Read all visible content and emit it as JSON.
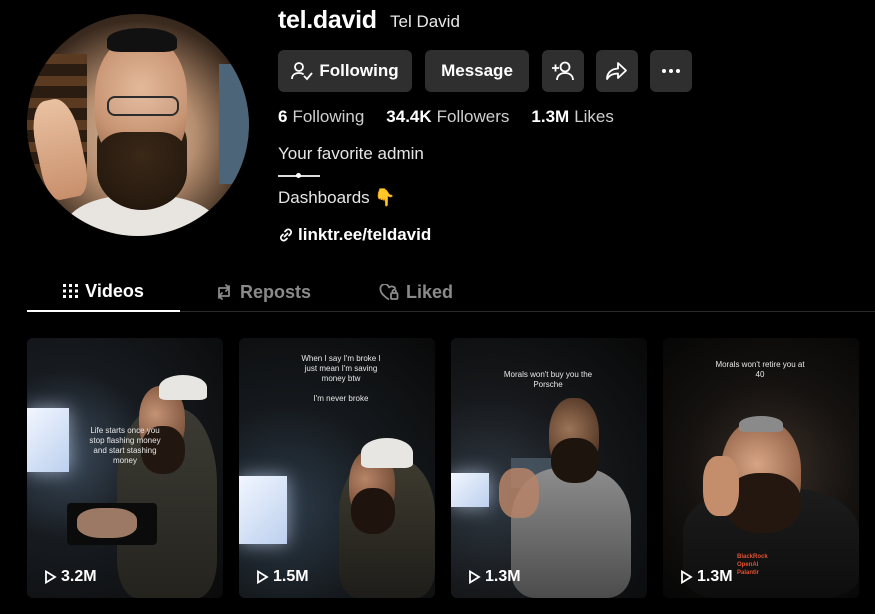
{
  "profile": {
    "username": "tel.david",
    "nickname": "Tel David",
    "buttons": {
      "following": "Following",
      "message": "Message",
      "add_friend_icon": "add-user-icon",
      "share_icon": "share-icon",
      "more_icon": "more-icon"
    },
    "stats": {
      "following_count": "6",
      "following_label": "Following",
      "followers_count": "34.4K",
      "followers_label": "Followers",
      "likes_count": "1.3M",
      "likes_label": "Likes"
    },
    "bio_line1": "Your favorite admin",
    "bio_line2": "Dashboards 👇",
    "link": "linktr.ee/teldavid"
  },
  "tabs": [
    {
      "label": "Videos",
      "active": true
    },
    {
      "label": "Reposts",
      "active": false
    },
    {
      "label": "Liked",
      "active": false
    }
  ],
  "videos": [
    {
      "overlay": "Life starts once you stop flashing money and start stashing money",
      "views": "3.2M"
    },
    {
      "overlay": "When I say I'm broke I just mean I'm saving money btw\n\nI'm never broke",
      "views": "1.5M"
    },
    {
      "overlay": "Morals won't buy you the Porsche",
      "views": "1.3M"
    },
    {
      "overlay": "Morals won't retire you at 40",
      "views": "1.3M"
    }
  ],
  "colors": {
    "background": "#000000",
    "button_bg": "#2f2f2f",
    "muted_text": "#8a8a8a"
  }
}
